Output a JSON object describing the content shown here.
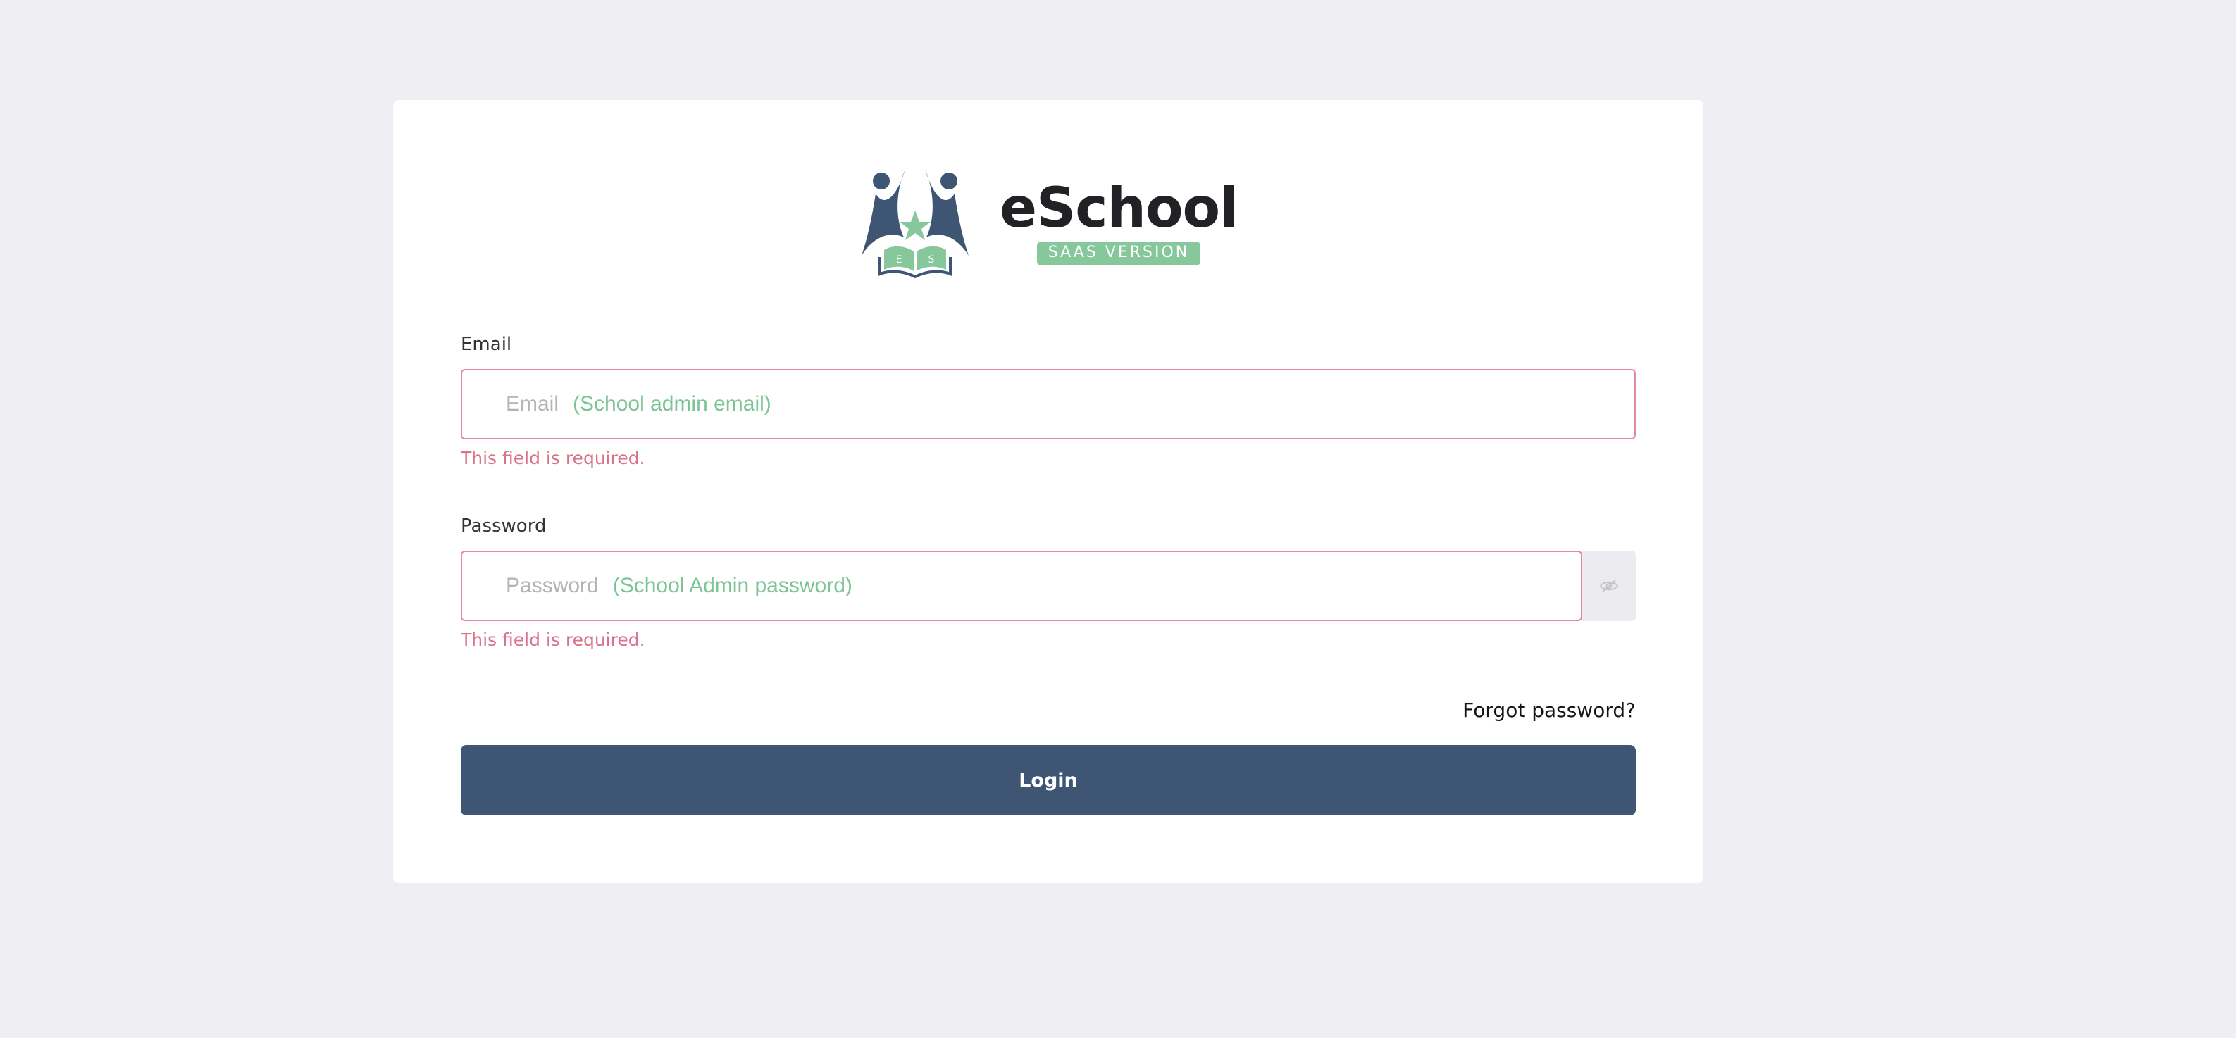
{
  "brand": {
    "name": "eSchool",
    "tagline": "SAAS VERSION",
    "logo_initials": [
      "E",
      "S"
    ]
  },
  "form": {
    "email": {
      "label": "Email",
      "placeholder": "Email",
      "hint": "(School admin email)",
      "value": "",
      "error": "This field is required."
    },
    "password": {
      "label": "Password",
      "placeholder": "Password",
      "hint": "(School Admin password)",
      "value": "",
      "error": "This field is required.",
      "toggle_icon": "eye-slash-icon"
    },
    "forgot_label": "Forgot password?",
    "login_label": "Login"
  },
  "colors": {
    "background": "#efeef3",
    "card": "#ffffff",
    "primary": "#3f5574",
    "accent_green": "#87c79c",
    "error": "#d9728a",
    "error_border": "#e38a9c"
  }
}
